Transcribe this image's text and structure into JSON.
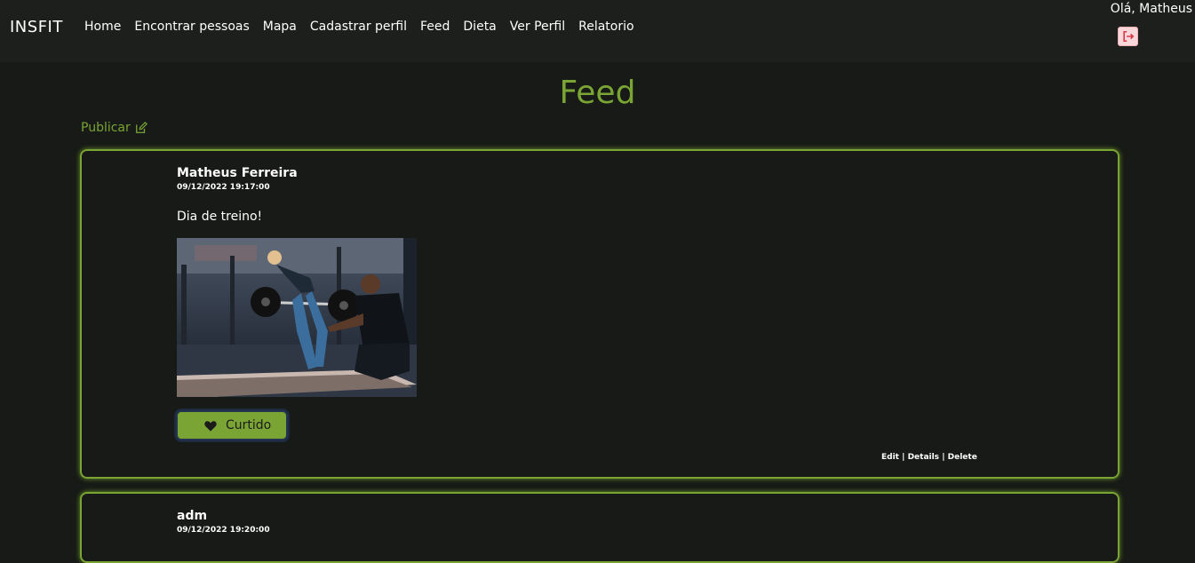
{
  "navbar": {
    "brand": "INSFIT",
    "links": [
      "Home",
      "Encontrar pessoas",
      "Mapa",
      "Cadastrar perfil",
      "Feed",
      "Dieta",
      "Ver Perfil",
      "Relatorio"
    ],
    "greeting": "Olá, Matheus",
    "logout_icon": "logout-icon"
  },
  "page": {
    "title": "Feed",
    "publish_label": "Publicar",
    "publish_icon": "edit-icon"
  },
  "posts": [
    {
      "author": "Matheus Ferreira",
      "date": "09/12/2022 19:17:00",
      "text": "Dia de treino!",
      "like_label": "Curtido",
      "like_icon": "heart-icon",
      "actions": [
        "Edit",
        "Details",
        "Delete"
      ],
      "action_separator": "|"
    },
    {
      "author": "adm",
      "date": "09/12/2022 19:20:00"
    }
  ],
  "colors": {
    "accent": "#7aa534",
    "background": "#171a16",
    "navbar": "#1c1f1b",
    "logout_bg": "#f8d7da"
  }
}
